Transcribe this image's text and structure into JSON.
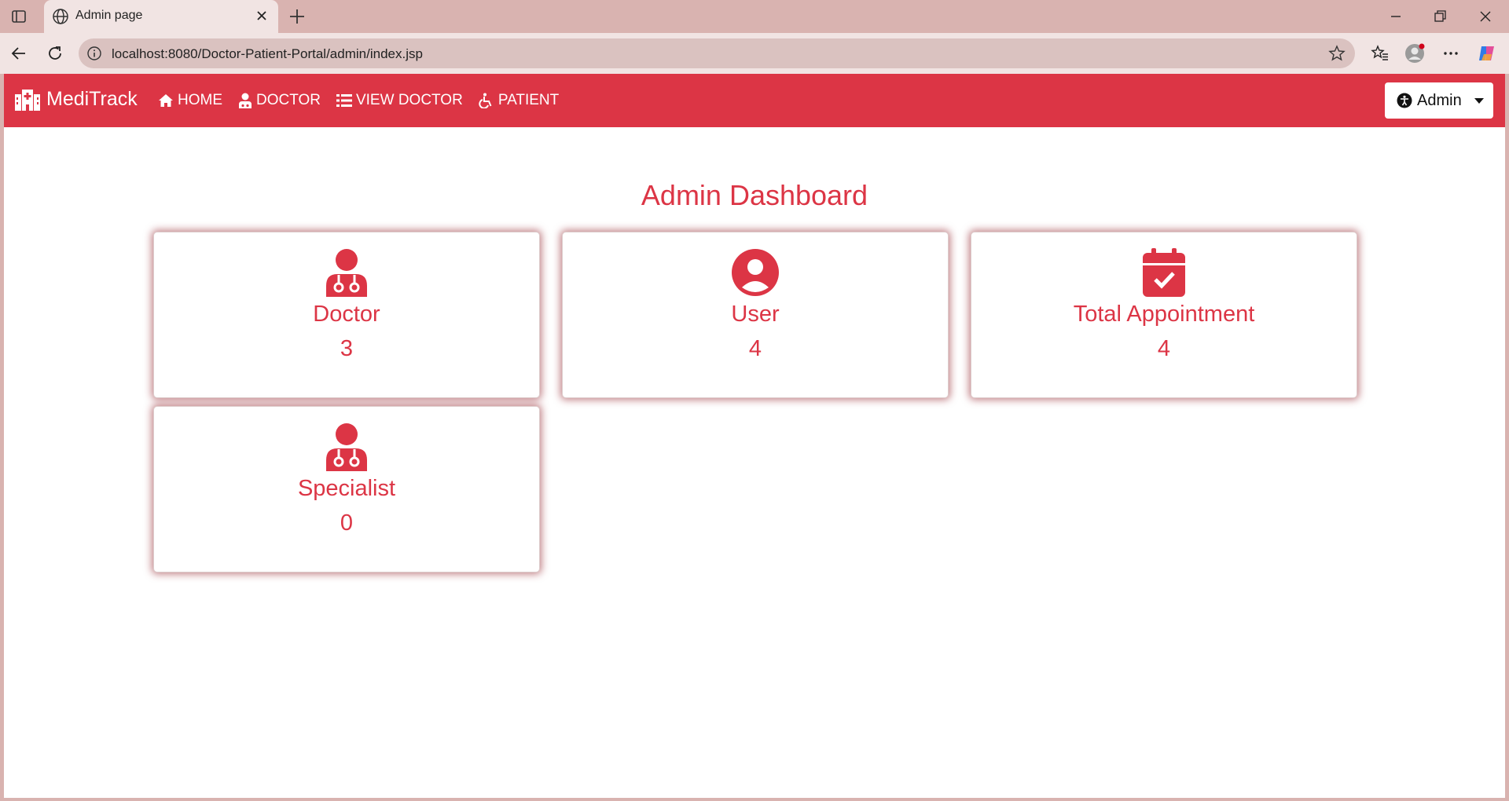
{
  "browser": {
    "tab_title": "Admin page",
    "url": "localhost:8080/Doctor-Patient-Portal/admin/index.jsp"
  },
  "navbar": {
    "brand": "MediTrack",
    "links": [
      {
        "label": "HOME",
        "icon": "home-icon"
      },
      {
        "label": "DOCTOR",
        "icon": "user-doctor-icon"
      },
      {
        "label": "VIEW DOCTOR",
        "icon": "list-icon"
      },
      {
        "label": "PATIENT",
        "icon": "wheelchair-icon"
      }
    ],
    "admin_label": "Admin"
  },
  "dashboard": {
    "title": "Admin Dashboard",
    "cards": [
      {
        "label": "Doctor",
        "value": "3",
        "icon": "user-doctor-icon"
      },
      {
        "label": "User",
        "value": "4",
        "icon": "user-circle-icon"
      },
      {
        "label": "Total Appointment",
        "value": "4",
        "icon": "calendar-check-icon"
      },
      {
        "label": "Specialist",
        "value": "0",
        "icon": "user-doctor-icon"
      }
    ]
  },
  "colors": {
    "primary": "#dc3545",
    "browser_frame": "#d9b3b0"
  }
}
